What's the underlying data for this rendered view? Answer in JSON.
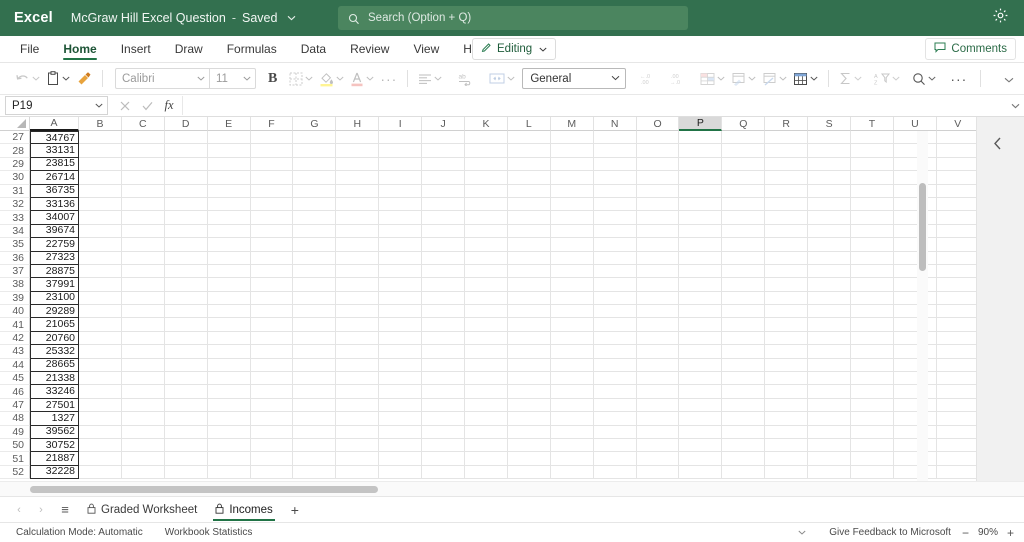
{
  "titlebar": {
    "app_name": "Excel",
    "doc_title": "McGraw Hill Excel Question",
    "dash": "-",
    "saved_label": "Saved",
    "chevron": "⌄",
    "search_placeholder": "Search (Option + Q)",
    "search_value": "",
    "brand_color": "#33704f"
  },
  "tabs": [
    {
      "label": "File",
      "active": false
    },
    {
      "label": "Home",
      "active": true
    },
    {
      "label": "Insert",
      "active": false
    },
    {
      "label": "Draw",
      "active": false
    },
    {
      "label": "Formulas",
      "active": false
    },
    {
      "label": "Data",
      "active": false
    },
    {
      "label": "Review",
      "active": false
    },
    {
      "label": "View",
      "active": false
    },
    {
      "label": "Help",
      "active": false
    }
  ],
  "tabstrip_buttons": {
    "editing_label": "Editing",
    "comments_label": "Comments"
  },
  "ribbon": {
    "font_name": "Calibri",
    "font_size": "11",
    "bold_label": "B",
    "number_format": "General",
    "more_label": "···",
    "accent_fill": "#ffe600",
    "accent_fontcolor": "#e8736b"
  },
  "formula_bar": {
    "name_box": "P19",
    "formula_value": "",
    "formula_placeholder": "",
    "fx_label": "fx"
  },
  "grid": {
    "columns": [
      "A",
      "B",
      "C",
      "D",
      "E",
      "F",
      "G",
      "H",
      "I",
      "J",
      "K",
      "L",
      "M",
      "N",
      "O",
      "P",
      "Q",
      "R",
      "S",
      "T",
      "U",
      "V"
    ],
    "selected_column": "P",
    "data_column": "A",
    "rows": [
      {
        "num": "27",
        "a": "34767"
      },
      {
        "num": "28",
        "a": "33131"
      },
      {
        "num": "29",
        "a": "23815"
      },
      {
        "num": "30",
        "a": "26714"
      },
      {
        "num": "31",
        "a": "36735"
      },
      {
        "num": "32",
        "a": "33136"
      },
      {
        "num": "33",
        "a": "34007"
      },
      {
        "num": "34",
        "a": "39674"
      },
      {
        "num": "35",
        "a": "22759"
      },
      {
        "num": "36",
        "a": "27323"
      },
      {
        "num": "37",
        "a": "28875"
      },
      {
        "num": "38",
        "a": "37991"
      },
      {
        "num": "39",
        "a": "23100"
      },
      {
        "num": "40",
        "a": "29289"
      },
      {
        "num": "41",
        "a": "21065"
      },
      {
        "num": "42",
        "a": "20760"
      },
      {
        "num": "43",
        "a": "25332"
      },
      {
        "num": "44",
        "a": "28665"
      },
      {
        "num": "45",
        "a": "21338"
      },
      {
        "num": "46",
        "a": "33246"
      },
      {
        "num": "47",
        "a": "27501"
      },
      {
        "num": "48",
        "a": "1327"
      },
      {
        "num": "49",
        "a": "39562"
      },
      {
        "num": "50",
        "a": "30752"
      },
      {
        "num": "51",
        "a": "21887"
      },
      {
        "num": "52",
        "a": "32228"
      }
    ]
  },
  "sheetbar": {
    "prev_arrow": "‹",
    "next_arrow": "›",
    "all_sheets": "≡",
    "add_label": "+",
    "sheets": [
      {
        "label": "Graded Worksheet",
        "active": false,
        "locked": true
      },
      {
        "label": "Incomes",
        "active": true,
        "locked": true
      }
    ]
  },
  "statusbar": {
    "calculation_mode": "Calculation Mode: Automatic",
    "workbook_statistics": "Workbook Statistics",
    "feedback": "Give Feedback to Microsoft",
    "zoom_minus": "−",
    "zoom_level": "90%",
    "zoom_plus": "+"
  }
}
